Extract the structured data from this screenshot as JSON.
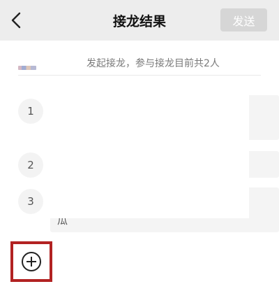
{
  "header": {
    "back_icon": "chevron-left-icon",
    "title": "接龙结果",
    "send_label": "发送"
  },
  "summary": {
    "text": "发起接龙，参与接龙目前共2人"
  },
  "entries": [
    {
      "number": "1"
    },
    {
      "number": "2"
    },
    {
      "number": "3",
      "text": "瓜"
    }
  ],
  "add_button": {
    "icon": "plus-circle-icon"
  },
  "colors": {
    "header_bg": "#ededed",
    "send_disabled_bg": "#d6d6d6",
    "highlight_border": "#b22222"
  }
}
